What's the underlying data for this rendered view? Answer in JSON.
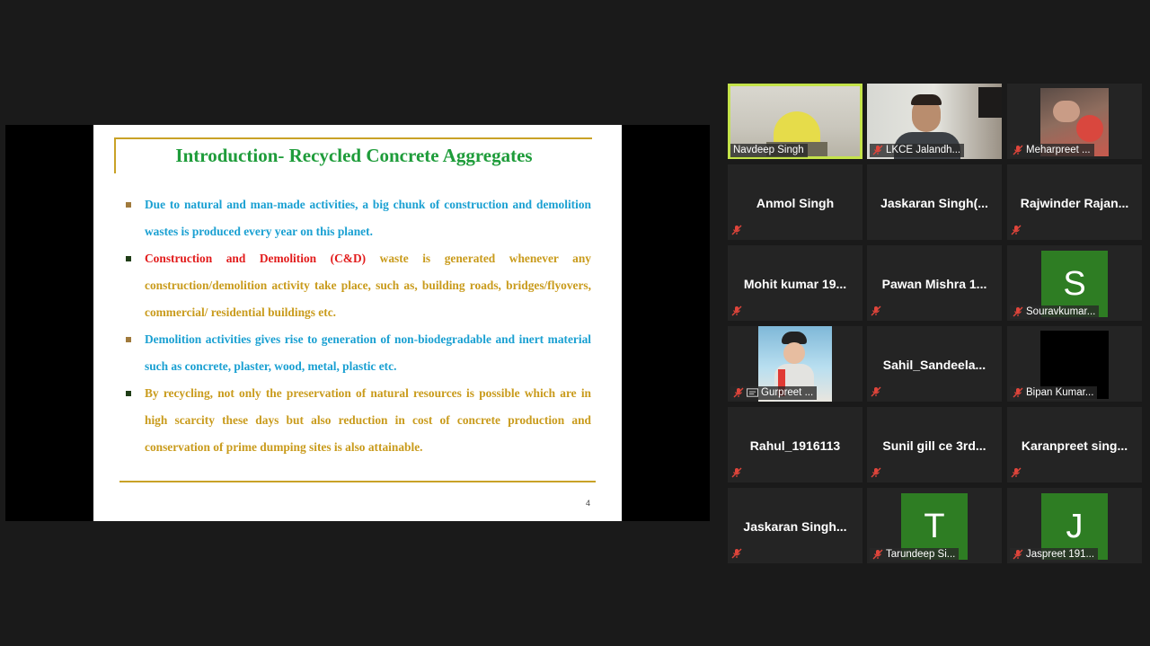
{
  "slide": {
    "title": "Introduction- Recycled Concrete Aggregates",
    "bullets": [
      {
        "segments": [
          {
            "text": "Due to natural and man-made activities, a big chunk of construction and demolition wastes is produced every year on this planet.",
            "tone": "blue"
          }
        ],
        "marker_color": "#a07a3c"
      },
      {
        "segments": [
          {
            "text": "Construction and Demolition (C&D)",
            "tone": "red"
          },
          {
            "text": " waste is generated whenever any construction/demolition activity take place, such as, building roads, bridges/flyovers, commercial/ residential buildings etc.",
            "tone": "gold"
          }
        ],
        "marker_color": "#1f3d16"
      },
      {
        "segments": [
          {
            "text": "Demolition activities gives rise to generation of non-biodegradable and inert material such as concrete, plaster, wood, metal, plastic etc.",
            "tone": "blue"
          }
        ],
        "marker_color": "#a07a3c"
      },
      {
        "segments": [
          {
            "text": "By recycling, not only the preservation of natural resources is possible which are in high scarcity these days but also reduction in cost of concrete production and conservation of prime dumping sites is also attainable.",
            "tone": "gold"
          }
        ],
        "marker_color": "#1f3d16"
      }
    ],
    "page_number": "4"
  },
  "participants": [
    {
      "name": "Navdeep Singh",
      "kind": "video",
      "muted": false,
      "active": true
    },
    {
      "name": "LKCE Jalandh...",
      "kind": "video",
      "muted": true
    },
    {
      "name": "Meharpreet ...",
      "kind": "video",
      "muted": true
    },
    {
      "name": "Anmol Singh",
      "kind": "name",
      "muted": true
    },
    {
      "name": "Jaskaran  Singh(...",
      "kind": "name",
      "muted": false
    },
    {
      "name": "Rajwinder  Rajan...",
      "kind": "name",
      "muted": true
    },
    {
      "name": "Mohit kumar 19...",
      "kind": "name",
      "muted": true
    },
    {
      "name": "Pawan Mishra 1...",
      "kind": "name",
      "muted": true
    },
    {
      "name": "Souravkumar...",
      "kind": "avatar",
      "letter": "S",
      "muted": true
    },
    {
      "name": "Gurpreet ...",
      "kind": "photo",
      "muted": true,
      "cc": true
    },
    {
      "name": "Sahil_Sandeela...",
      "kind": "name",
      "muted": true
    },
    {
      "name": "Bipan Kumar...",
      "kind": "black",
      "muted": true
    },
    {
      "name": "Rahul_1916113",
      "kind": "name",
      "muted": true
    },
    {
      "name": "Sunil gill ce 3rd...",
      "kind": "name",
      "muted": true
    },
    {
      "name": "Karanpreet  sing...",
      "kind": "name",
      "muted": true
    },
    {
      "name": "Jaskaran  Singh...",
      "kind": "name",
      "muted": true
    },
    {
      "name": "Tarundeep Si...",
      "kind": "avatar",
      "letter": "T",
      "muted": true
    },
    {
      "name": "Jaspreet 191...",
      "kind": "avatar",
      "letter": "J",
      "muted": true
    }
  ],
  "colors": {
    "active_border": "#c4e34a",
    "avatar_bg": "#2e7d23",
    "muted_mic": "#e0453b",
    "title_green": "#1e9c3a"
  },
  "icons": {
    "muted": "muted-mic-icon",
    "captions": "closed-caption-icon"
  }
}
